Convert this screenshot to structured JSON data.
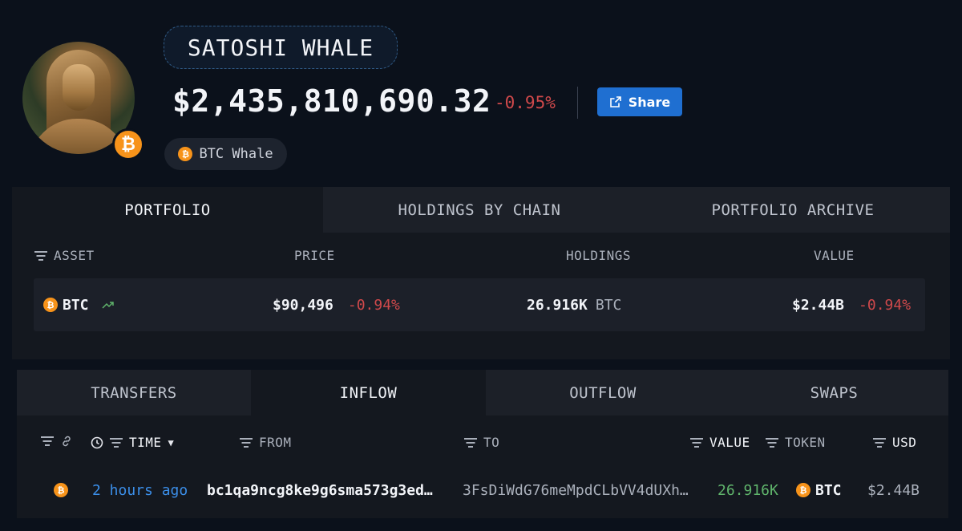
{
  "entity": {
    "name": "SATOSHI WHALE",
    "total_value": "$2,435,810,690.32",
    "change": "-0.95%",
    "share_label": "Share",
    "tag_label": "BTC Whale",
    "btc_symbol": "₿"
  },
  "portfolio_tabs": [
    "PORTFOLIO",
    "HOLDINGS BY CHAIN",
    "PORTFOLIO ARCHIVE"
  ],
  "portfolio_columns": {
    "asset": "ASSET",
    "price": "PRICE",
    "holdings": "HOLDINGS",
    "value": "VALUE"
  },
  "portfolio_row": {
    "asset": "BTC",
    "price": "$90,496",
    "price_change": "-0.94%",
    "holdings": "26.916K",
    "holdings_unit": "BTC",
    "value": "$2.44B",
    "value_change": "-0.94%"
  },
  "flow_tabs": [
    "TRANSFERS",
    "INFLOW",
    "OUTFLOW",
    "SWAPS"
  ],
  "flow_columns": {
    "time": "TIME",
    "from": "FROM",
    "to": "TO",
    "value": "VALUE",
    "token": "TOKEN",
    "usd": "USD"
  },
  "flow_row": {
    "time": "2 hours ago",
    "from": "bc1qa9ncg8ke9g6sma573g3ed…",
    "to": "3FsDiWdG76meMpdCLbVV4dUXh…",
    "value": "26.916K",
    "token": "BTC",
    "usd": "$2.44B"
  },
  "colors": {
    "accent": "#1f6fd1",
    "negative": "#d0494b",
    "positive": "#5fb36b",
    "btc": "#f7931a",
    "link": "#3b8ee8"
  }
}
